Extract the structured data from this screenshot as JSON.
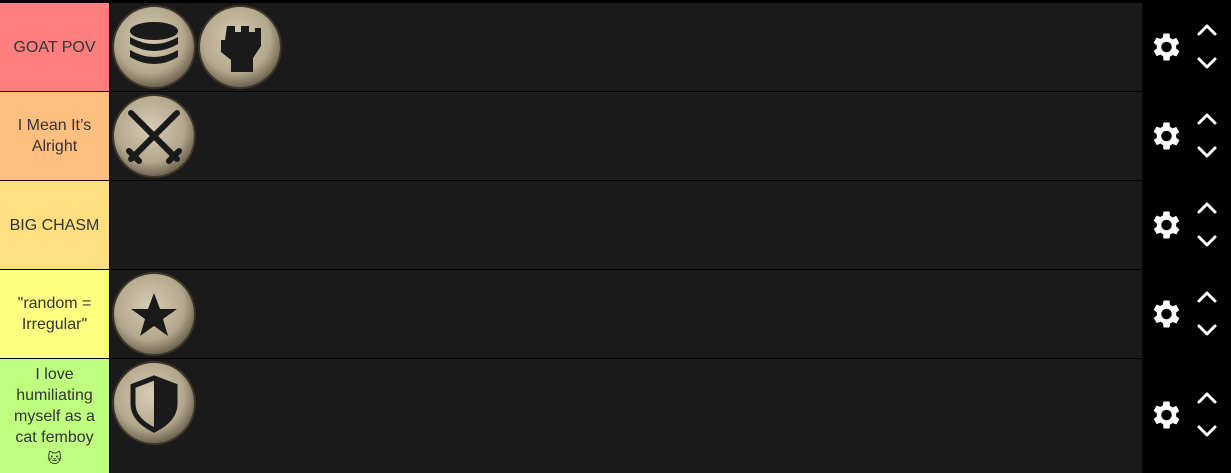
{
  "tiers": [
    {
      "label": "GOAT POV",
      "color": "#ff7f7f",
      "items": [
        "coins-icon",
        "fist-icon"
      ]
    },
    {
      "label": "I Mean It’s Alright",
      "color": "#ffbf7f",
      "items": [
        "crossed-swords-icon"
      ]
    },
    {
      "label": "BIG CHASM",
      "color": "#ffdf7f",
      "items": []
    },
    {
      "label": "\"random = Irregular\"",
      "color": "#ffff7f",
      "items": [
        "star-icon"
      ]
    },
    {
      "label": "I love humiliating myself as a cat femboy",
      "label_emoji": "🐱",
      "color": "#bfff7f",
      "items": [
        "shield-icon"
      ]
    }
  ],
  "controls": {
    "settings_icon": "gear-icon",
    "move_up_icon": "chevron-up-icon",
    "move_down_icon": "chevron-down-icon"
  },
  "theme": {
    "items_bg": "#1a1a1a",
    "token_bg": "#c4b8a0",
    "token_fg": "#1a1a1a"
  }
}
